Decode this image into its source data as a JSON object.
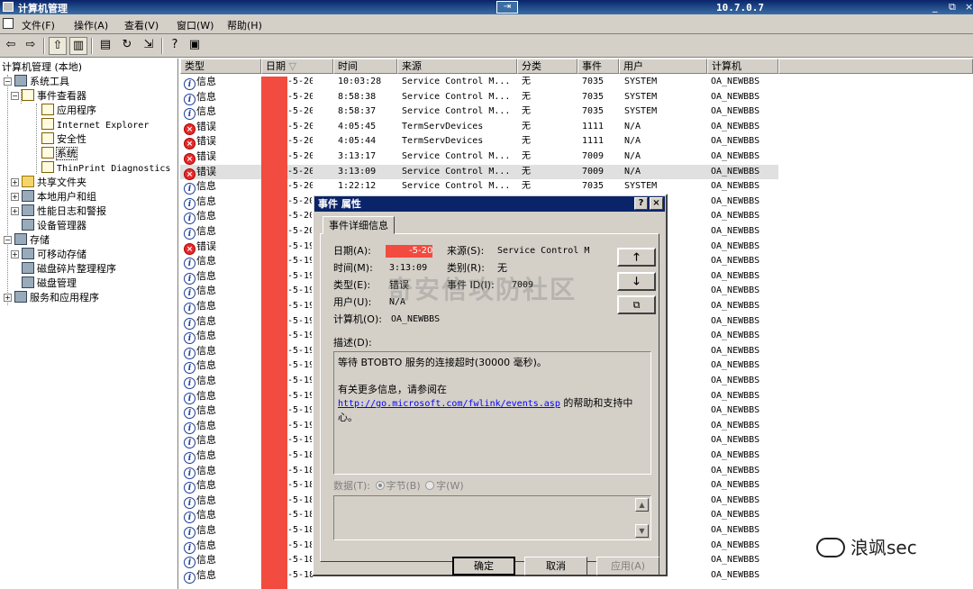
{
  "window": {
    "title": "计算机管理",
    "ip": "10.7.0.7",
    "pin_label": "⇥",
    "controls": [
      "_",
      "⧉",
      "×"
    ]
  },
  "menubar": [
    "文件(F)",
    "操作(A)",
    "查看(V)",
    "窗口(W)",
    "帮助(H)"
  ],
  "tree": {
    "root": "计算机管理 (本地)",
    "system_tools": "系统工具",
    "event_viewer": "事件查看器",
    "logs": [
      "应用程序",
      "Internet Explorer",
      "安全性",
      "系统",
      "ThinPrint Diagnostics"
    ],
    "shared_folders": "共享文件夹",
    "local_users": "本地用户和组",
    "perf_logs": "性能日志和警报",
    "device_manager": "设备管理器",
    "storage": "存储",
    "removable": "可移动存储",
    "defrag": "磁盘碎片整理程序",
    "disk_mgmt": "磁盘管理",
    "services_apps": "服务和应用程序"
  },
  "columns": [
    "类型",
    "日期",
    "时间",
    "来源",
    "分类",
    "事件",
    "用户",
    "计算机"
  ],
  "rows": [
    {
      "type": "info",
      "label": "信息",
      "date": "-5-20",
      "time": "10:03:28",
      "source": "Service Control M...",
      "cat": "无",
      "event": "7035",
      "user": "SYSTEM",
      "computer": "OA_NEWBBS"
    },
    {
      "type": "info",
      "label": "信息",
      "date": "-5-20",
      "time": "8:58:38",
      "source": "Service Control M...",
      "cat": "无",
      "event": "7035",
      "user": "SYSTEM",
      "computer": "OA_NEWBBS"
    },
    {
      "type": "info",
      "label": "信息",
      "date": "-5-20",
      "time": "8:58:37",
      "source": "Service Control M...",
      "cat": "无",
      "event": "7035",
      "user": "SYSTEM",
      "computer": "OA_NEWBBS"
    },
    {
      "type": "err",
      "label": "错误",
      "date": "-5-20",
      "time": "4:05:45",
      "source": "TermServDevices",
      "cat": "无",
      "event": "1111",
      "user": "N/A",
      "computer": "OA_NEWBBS"
    },
    {
      "type": "err",
      "label": "错误",
      "date": "-5-20",
      "time": "4:05:44",
      "source": "TermServDevices",
      "cat": "无",
      "event": "1111",
      "user": "N/A",
      "computer": "OA_NEWBBS"
    },
    {
      "type": "err",
      "label": "错误",
      "date": "-5-20",
      "time": "3:13:17",
      "source": "Service Control M...",
      "cat": "无",
      "event": "7009",
      "user": "N/A",
      "computer": "OA_NEWBBS"
    },
    {
      "type": "err",
      "label": "错误",
      "date": "-5-20",
      "time": "3:13:09",
      "source": "Service Control M...",
      "cat": "无",
      "event": "7009",
      "user": "N/A",
      "computer": "OA_NEWBBS"
    },
    {
      "type": "info",
      "label": "信息",
      "date": "-5-20",
      "time": "1:22:12",
      "source": "Service Control M...",
      "cat": "无",
      "event": "7035",
      "user": "SYSTEM",
      "computer": "OA_NEWBBS"
    },
    {
      "type": "info",
      "label": "信息",
      "date": "-5-20",
      "computer": "OA_NEWBBS"
    },
    {
      "type": "info",
      "label": "信息",
      "date": "-5-20",
      "computer": "OA_NEWBBS"
    },
    {
      "type": "info",
      "label": "信息",
      "date": "-5-20",
      "computer": "OA_NEWBBS"
    },
    {
      "type": "err",
      "label": "错误",
      "date": "-5-19",
      "computer": "OA_NEWBBS"
    },
    {
      "type": "info",
      "label": "信息",
      "date": "-5-19",
      "computer": "OA_NEWBBS"
    },
    {
      "type": "info",
      "label": "信息",
      "date": "-5-19",
      "computer": "OA_NEWBBS"
    },
    {
      "type": "info",
      "label": "信息",
      "date": "-5-19",
      "computer": "OA_NEWBBS"
    },
    {
      "type": "info",
      "label": "信息",
      "date": "-5-19",
      "computer": "OA_NEWBBS"
    },
    {
      "type": "info",
      "label": "信息",
      "date": "-5-19",
      "computer": "OA_NEWBBS"
    },
    {
      "type": "info",
      "label": "信息",
      "date": "-5-19",
      "computer": "OA_NEWBBS"
    },
    {
      "type": "info",
      "label": "信息",
      "date": "-5-19",
      "computer": "OA_NEWBBS"
    },
    {
      "type": "info",
      "label": "信息",
      "date": "-5-19",
      "computer": "OA_NEWBBS"
    },
    {
      "type": "info",
      "label": "信息",
      "date": "-5-19",
      "computer": "OA_NEWBBS"
    },
    {
      "type": "info",
      "label": "信息",
      "date": "-5-19",
      "computer": "OA_NEWBBS"
    },
    {
      "type": "info",
      "label": "信息",
      "date": "-5-19",
      "computer": "OA_NEWBBS"
    },
    {
      "type": "info",
      "label": "信息",
      "date": "-5-19",
      "computer": "OA_NEWBBS"
    },
    {
      "type": "info",
      "label": "信息",
      "date": "-5-19",
      "computer": "OA_NEWBBS"
    },
    {
      "type": "info",
      "label": "信息",
      "date": "-5-18",
      "computer": "OA_NEWBBS"
    },
    {
      "type": "info",
      "label": "信息",
      "date": "-5-18",
      "computer": "OA_NEWBBS"
    },
    {
      "type": "info",
      "label": "信息",
      "date": "-5-18",
      "computer": "OA_NEWBBS"
    },
    {
      "type": "info",
      "label": "信息",
      "date": "-5-18",
      "computer": "OA_NEWBBS"
    },
    {
      "type": "info",
      "label": "信息",
      "date": "-5-18",
      "computer": "OA_NEWBBS"
    },
    {
      "type": "info",
      "label": "信息",
      "date": "-5-18",
      "computer": "OA_NEWBBS"
    },
    {
      "type": "info",
      "label": "信息",
      "date": "-5-18",
      "computer": "OA_NEWBBS"
    },
    {
      "type": "info",
      "label": "信息",
      "date": "-5-18",
      "computer": "OA_NEWBBS"
    },
    {
      "type": "info",
      "label": "信息",
      "date": "-5-18",
      "computer": "OA_NEWBBS"
    }
  ],
  "dialog": {
    "title": "事件 属性",
    "help": "?",
    "close": "×",
    "tab": "事件详细信息",
    "date_label": "日期(A):",
    "date_value": "-5-20",
    "source_label": "来源(S):",
    "source_value": "Service Control M",
    "time_label": "时间(M):",
    "time_value": "3:13:09",
    "category_label": "类别(R):",
    "category_value": "无",
    "type_label": "类型(E):",
    "type_value": "错误",
    "event_id_label": "事件 ID(I):",
    "event_id_value": "7009",
    "user_label": "用户(U):",
    "user_value": "N/A",
    "computer_label": "计算机(O):",
    "computer_value": "OA_NEWBBS",
    "desc_label": "描述(D):",
    "desc_line1": "等待 BTOBTO 服务的连接超时(30000 毫秒)。",
    "desc_line2": "有关更多信息，请参阅在",
    "desc_url": "http://go.microsoft.com/fwlink/events.asp",
    "desc_line3": "的帮助和支持中",
    "desc_line4": "心。",
    "data_label": "数据(T):",
    "bytes_label": "字节(B)",
    "words_label": "字(W)",
    "ok": "确定",
    "cancel": "取消",
    "apply": "应用(A)"
  },
  "watermark": "奇安信攻防社区",
  "wechat_label": "浪飒sec",
  "colors": {
    "redaction": "#f24b3f",
    "title_bar": "#0a246a",
    "chrome": "#d4d0c8",
    "link": "#0000ff"
  }
}
